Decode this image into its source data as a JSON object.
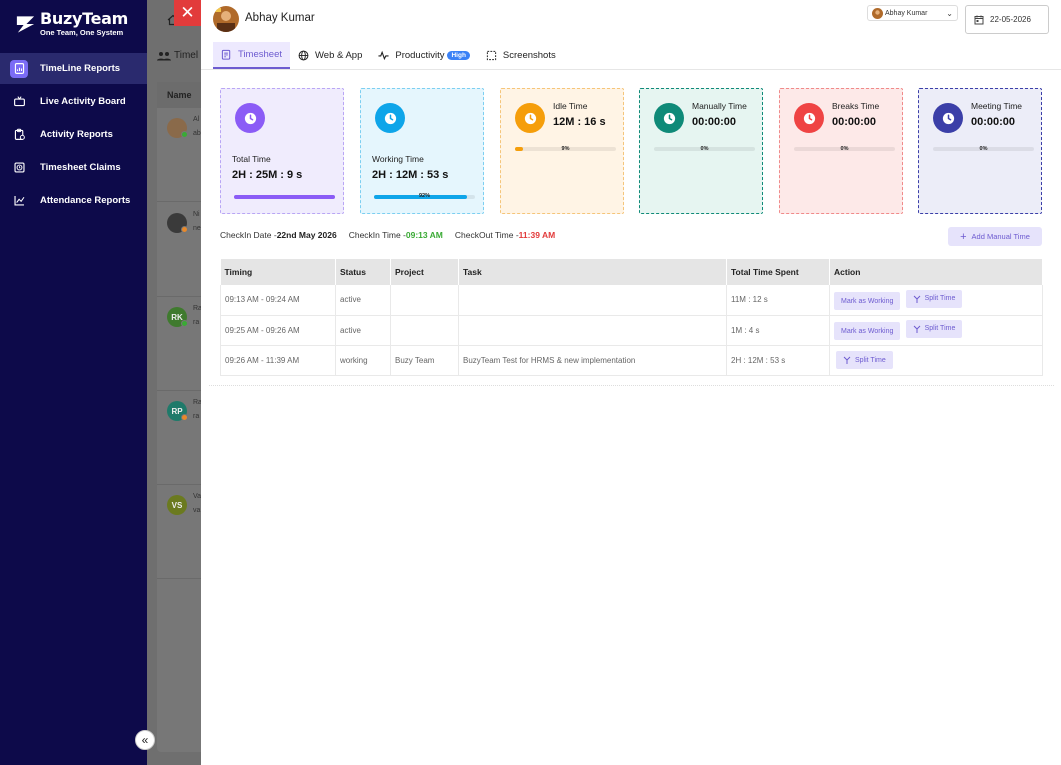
{
  "brand": {
    "name": "BuzyTeam",
    "tagline": "One Team, One System"
  },
  "sidebar": {
    "items": [
      {
        "label": "TimeLine Reports",
        "icon": "report-icon",
        "active": true
      },
      {
        "label": "Live Activity Board",
        "icon": "tv-icon",
        "active": false
      },
      {
        "label": "Activity Reports",
        "icon": "clipboard-icon",
        "active": false
      },
      {
        "label": "Timesheet Claims",
        "icon": "clock-doc-icon",
        "active": false
      },
      {
        "label": "Attendance Reports",
        "icon": "chart-icon",
        "active": false
      }
    ],
    "collapse_glyph": "«"
  },
  "background": {
    "tab_label": "Timel",
    "column_name": "Name",
    "rows": [
      {
        "initials": "",
        "snippet_top": "Al",
        "snippet_bottom": "ab",
        "avatar_color": "#8a6a4a",
        "status": "#3aaa35"
      },
      {
        "initials": "",
        "snippet_top": "Ni",
        "snippet_bottom": "ne",
        "avatar_color": "#3a3a3a",
        "status": "#e8892b"
      },
      {
        "initials": "RK",
        "snippet_top": "Ra",
        "snippet_bottom": "ra",
        "avatar_color": "#3f7a2e",
        "status": "#3aaa35"
      },
      {
        "initials": "RP",
        "snippet_top": "Ra",
        "snippet_bottom": "ra",
        "avatar_color": "#1f7a6a",
        "status": "#e8892b"
      },
      {
        "initials": "VS",
        "snippet_top": "Va",
        "snippet_bottom": "va",
        "avatar_color": "#6b7a1f",
        "status": ""
      }
    ]
  },
  "close_glyph": "✕",
  "header": {
    "user_name": "Abhay Kumar",
    "user_select_value": "Abhay Kumar",
    "date": "22-05-2026"
  },
  "tabs": [
    {
      "label": "Timesheet",
      "icon": "timesheet-icon",
      "active": true
    },
    {
      "label": "Web & App",
      "icon": "globe-icon",
      "active": false
    },
    {
      "label": "Productivity",
      "icon": "pulse-icon",
      "active": false,
      "badge": "High"
    },
    {
      "label": "Screenshots",
      "icon": "screenshot-icon",
      "active": false
    }
  ],
  "cards": [
    {
      "label": "Total Time",
      "value": "2H : 25M : 9 s",
      "color": "#8b5cf6",
      "bg": "#f0ecfd",
      "border": "#b9a6f5",
      "progress": 100,
      "pct_label": ""
    },
    {
      "label": "Working Time",
      "value": "2H : 12M : 53 s",
      "color": "#0ea5e9",
      "bg": "#e5f6fd",
      "border": "#7dcff1",
      "progress": 92,
      "pct_label": "92%"
    },
    {
      "label": "Idle Time",
      "value": "12M : 16 s",
      "color": "#f59e0b",
      "bg": "#fff4e5",
      "border": "#f5c57a",
      "progress": 8,
      "pct_label": "9%"
    },
    {
      "label": "Manually Time",
      "value": "00:00:00",
      "color": "#0f8a78",
      "bg": "#e6f5f1",
      "border": "#0f8a78",
      "progress": 0,
      "pct_label": "0%"
    },
    {
      "label": "Breaks Time",
      "value": "00:00:00",
      "color": "#ef4444",
      "bg": "#fde9e8",
      "border": "#f08a8a",
      "progress": 0,
      "pct_label": "0%"
    },
    {
      "label": "Meeting Time",
      "value": "00:00:00",
      "color": "#3b3fa8",
      "bg": "#ecedf8",
      "border": "#3b3fa8",
      "progress": 0,
      "pct_label": "0%"
    }
  ],
  "checkin": {
    "date_label": "CheckIn Date -",
    "date_value": "22nd May 2026",
    "in_label": "CheckIn Time -",
    "in_value": "09:13 AM",
    "out_label": "CheckOut Time -",
    "out_value": "11:39 AM"
  },
  "add_manual_label": "Add Manual Time",
  "table": {
    "headers": [
      "Timing",
      "Status",
      "Project",
      "Task",
      "Total Time Spent",
      "Action"
    ],
    "rows": [
      {
        "timing": "09:13 AM - 09:24 AM",
        "status": "active",
        "project": "",
        "task": "",
        "total": "11M : 12 s",
        "mark": "Mark as Working",
        "split": "Split Time"
      },
      {
        "timing": "09:25 AM - 09:26 AM",
        "status": "active",
        "project": "",
        "task": "",
        "total": "1M : 4 s",
        "mark": "Mark as Working",
        "split": "Split Time"
      },
      {
        "timing": "09:26 AM - 11:39 AM",
        "status": "working",
        "project": "Buzy Team",
        "task": "BuzyTeam Test for HRMS & new implementation",
        "total": "2H : 12M : 53 s",
        "mark": "",
        "split": "Split Time"
      }
    ]
  }
}
